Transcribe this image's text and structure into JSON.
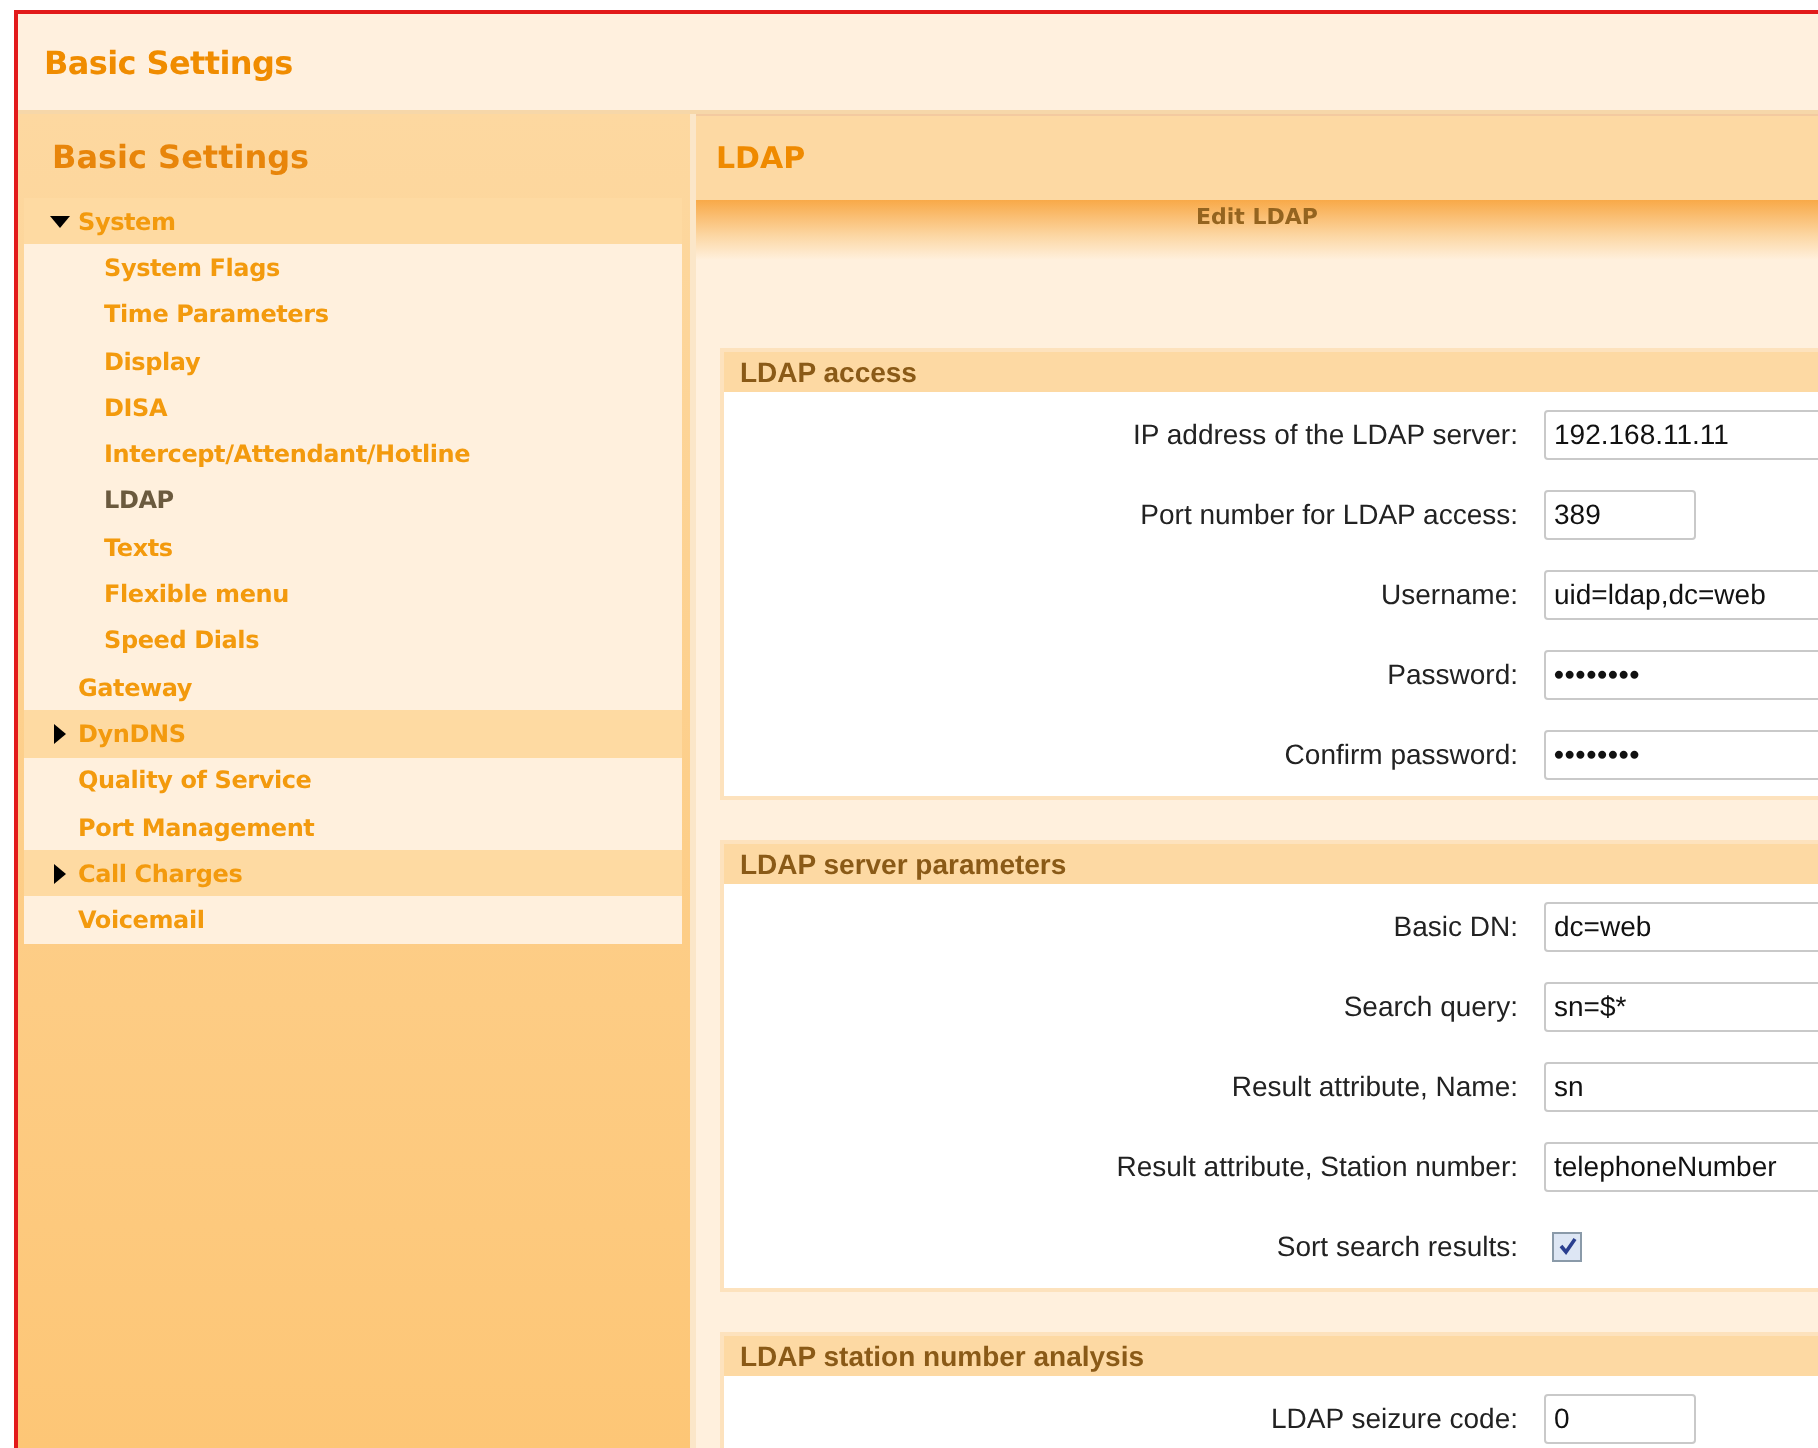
{
  "header": {
    "title": "Basic Settings"
  },
  "sidebar": {
    "title": "Basic Settings",
    "items": [
      {
        "label": "System",
        "kind": "group",
        "expanded": true,
        "selected": false,
        "children": [
          {
            "label": "System Flags",
            "kind": "page",
            "selected": false
          },
          {
            "label": "Time Parameters",
            "kind": "page",
            "selected": false
          },
          {
            "label": "Display",
            "kind": "page",
            "selected": false
          },
          {
            "label": "DISA",
            "kind": "page",
            "selected": false
          },
          {
            "label": "Intercept/Attendant/Hotline",
            "kind": "page",
            "selected": false
          },
          {
            "label": "LDAP",
            "kind": "page",
            "selected": true
          },
          {
            "label": "Texts",
            "kind": "page",
            "selected": false
          },
          {
            "label": "Flexible menu",
            "kind": "page",
            "selected": false
          },
          {
            "label": "Speed Dials",
            "kind": "page",
            "selected": false
          }
        ]
      },
      {
        "label": "Gateway",
        "kind": "page",
        "selected": false
      },
      {
        "label": "DynDNS",
        "kind": "group",
        "expanded": false,
        "selected": false
      },
      {
        "label": "Quality of Service",
        "kind": "page",
        "selected": false
      },
      {
        "label": "Port Management",
        "kind": "page",
        "selected": false
      },
      {
        "label": "Call Charges",
        "kind": "group",
        "expanded": false,
        "selected": false
      },
      {
        "label": "Voicemail",
        "kind": "page",
        "selected": false
      }
    ]
  },
  "content": {
    "title": "LDAP",
    "subtitle": "Edit LDAP",
    "sections": [
      {
        "title": "LDAP access",
        "fields": [
          {
            "label": "IP address of the LDAP server:",
            "kind": "text",
            "value": "192.168.11.11"
          },
          {
            "label": "Port number for LDAP access:",
            "kind": "number",
            "value": "389"
          },
          {
            "label": "Username:",
            "kind": "text",
            "value": "uid=ldap,dc=web"
          },
          {
            "label": "Password:",
            "kind": "password",
            "value": "••••••••"
          },
          {
            "label": "Confirm password:",
            "kind": "password",
            "value": "••••••••"
          }
        ]
      },
      {
        "title": "LDAP server parameters",
        "fields": [
          {
            "label": "Basic DN:",
            "kind": "text",
            "value": "dc=web"
          },
          {
            "label": "Search query:",
            "kind": "text",
            "value": "sn=$*"
          },
          {
            "label": "Result attribute, Name:",
            "kind": "text",
            "value": "sn"
          },
          {
            "label": "Result attribute, Station number:",
            "kind": "text",
            "value": "telephoneNumber"
          },
          {
            "label": "Sort search results:",
            "kind": "checkbox",
            "checked": true
          }
        ]
      },
      {
        "title": "LDAP station number analysis",
        "fields": [
          {
            "label": "LDAP seizure code:",
            "kind": "number",
            "value": "0"
          }
        ]
      }
    ]
  }
}
